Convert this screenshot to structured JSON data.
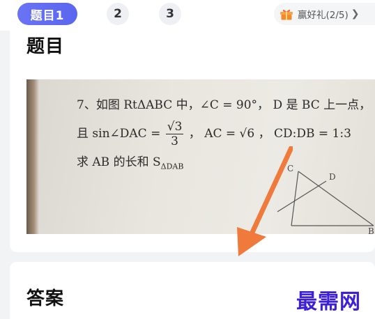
{
  "tabs": [
    {
      "label": "题目1",
      "active": true
    },
    {
      "label": "2",
      "active": false
    },
    {
      "label": "3",
      "active": false
    }
  ],
  "gift": {
    "label": "赢好礼(2/5)",
    "icon": "gift-icon",
    "chevron_icon": "chevron-right-icon"
  },
  "question": {
    "heading": "题目",
    "photo": {
      "line1": "7、如图 RtΔABC 中，∠C = 90°， D 是 BC 上一点，",
      "line2_prefix": "且 sin∠DAC =",
      "frac_num": "√3",
      "frac_den": "3",
      "line2_suffix": "， AC = √6 ， CD:DB = 1:3",
      "line3_a": "求 AB 的长和 S",
      "line3_sub": "ΔDAB",
      "diagram_labels": {
        "c": "C",
        "d": "D",
        "b": "B"
      }
    }
  },
  "answer": {
    "heading": "答案"
  },
  "watermark": "最需网",
  "colors": {
    "accent": "#5a66ee",
    "arrow": "#f07a3c",
    "watermark": "#3d1fd6"
  }
}
